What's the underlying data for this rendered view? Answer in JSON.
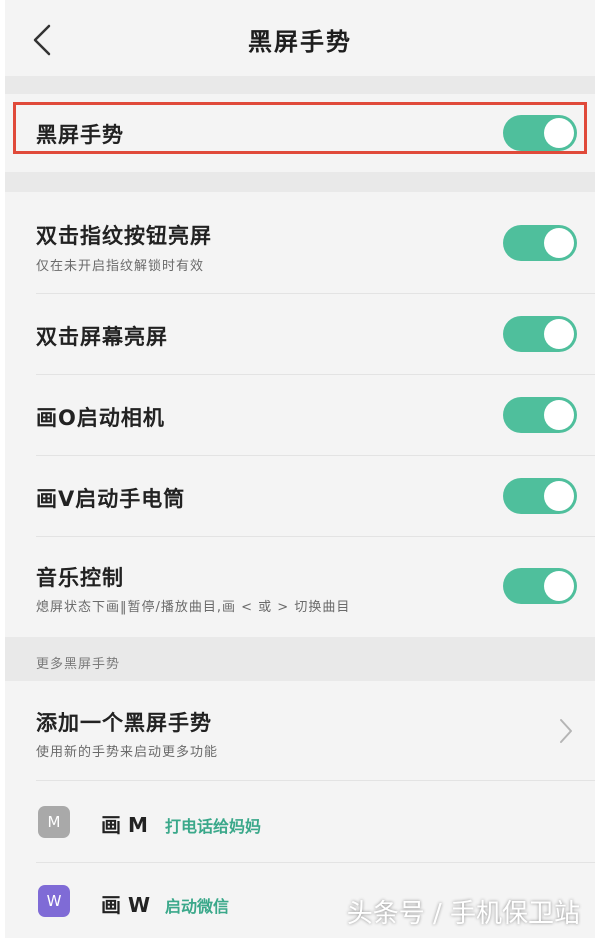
{
  "header": {
    "title": "黑屏手势"
  },
  "master": {
    "label": "黑屏手势",
    "enabled": true
  },
  "settings": [
    {
      "label": "双击指纹按钮亮屏",
      "sub": "仅在未开启指纹解锁时有效",
      "enabled": true
    },
    {
      "label": "双击屏幕亮屏",
      "sub": "",
      "enabled": true
    },
    {
      "label": "画O启动相机",
      "sub": "",
      "enabled": true
    },
    {
      "label": "画V启动手电筒",
      "sub": "",
      "enabled": true
    },
    {
      "label": "音乐控制",
      "sub": "熄屏状态下画‖暂停/播放曲目,画 < 或 > 切换曲目",
      "enabled": true
    }
  ],
  "more": {
    "section_label": "更多黑屏手势",
    "add": {
      "label": "添加一个黑屏手势",
      "sub": "使用新的手势来启动更多功能"
    },
    "gestures": [
      {
        "badge": "M",
        "name": "画 M",
        "action": "打电话给妈妈",
        "color": "#a9a9a9"
      },
      {
        "badge": "W",
        "name": "画 W",
        "action": "启动微信",
        "color": "#7f6bd6"
      }
    ]
  },
  "watermark": "头条号 / 手机保卫站",
  "colors": {
    "toggle_on": "#4fbf9c",
    "highlight": "#e04a3a",
    "accent_text": "#3aa88a"
  },
  "icons": {
    "back": "chevron-left-icon",
    "more": "chevron-right-icon"
  }
}
